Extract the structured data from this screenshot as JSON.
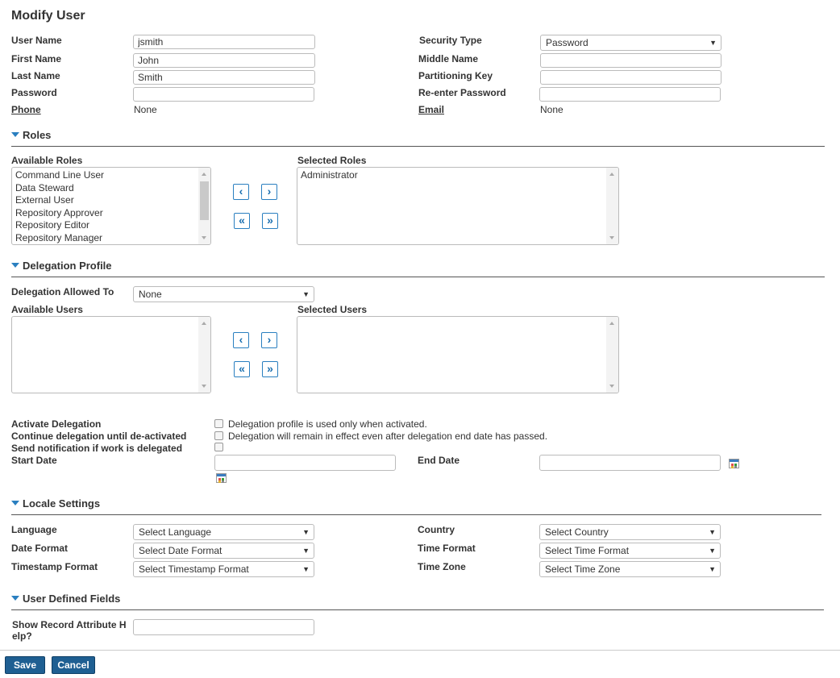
{
  "page": {
    "title": "Modify User"
  },
  "user": {
    "user_name_label": "User Name",
    "user_name_value": "jsmith",
    "first_name_label": "First Name",
    "first_name_value": "John",
    "last_name_label": "Last Name",
    "last_name_value": "Smith",
    "password_label": "Password",
    "phone_label": "Phone",
    "phone_value": "None",
    "security_type_label": "Security Type",
    "security_type_value": "Password",
    "middle_name_label": "Middle Name",
    "partitioning_key_label": "Partitioning Key",
    "reenter_password_label": "Re-enter Password",
    "email_label": "Email",
    "email_value": "None"
  },
  "roles": {
    "section_title": "Roles",
    "available_label": "Available Roles",
    "selected_label": "Selected Roles",
    "available": [
      "Command Line User",
      "Data Steward",
      "External User",
      "Repository Approver",
      "Repository Editor",
      "Repository Manager"
    ],
    "selected": [
      "Administrator"
    ]
  },
  "delegation": {
    "section_title": "Delegation Profile",
    "allowed_to_label": "Delegation Allowed To",
    "allowed_to_value": "None",
    "available_users_label": "Available Users",
    "selected_users_label": "Selected Users",
    "activate_label": "Activate Delegation",
    "activate_desc": "Delegation profile is used only when activated.",
    "continue_label": "Continue delegation until de-activated",
    "continue_desc": "Delegation will remain in effect even after delegation end date has passed.",
    "notify_label": "Send notification if work is delegated",
    "start_date_label": "Start Date",
    "end_date_label": "End Date"
  },
  "locale": {
    "section_title": "Locale Settings",
    "language_label": "Language",
    "language_value": "Select Language",
    "date_format_label": "Date Format",
    "date_format_value": "Select Date Format",
    "timestamp_format_label": "Timestamp Format",
    "timestamp_format_value": "Select Timestamp Format",
    "country_label": "Country",
    "country_value": "Select Country",
    "time_format_label": "Time Format",
    "time_format_value": "Select Time Format",
    "time_zone_label": "Time Zone",
    "time_zone_value": "Select Time Zone"
  },
  "udf": {
    "section_title": "User Defined Fields",
    "show_help_label_line1": "Show Record Attribute H",
    "show_help_label_line2": "elp?"
  },
  "footer": {
    "save_label": "Save",
    "cancel_label": "Cancel"
  },
  "icons": {
    "left": "‹",
    "right": "›",
    "all_left": "«",
    "all_right": "»",
    "dropdown": "▼"
  }
}
